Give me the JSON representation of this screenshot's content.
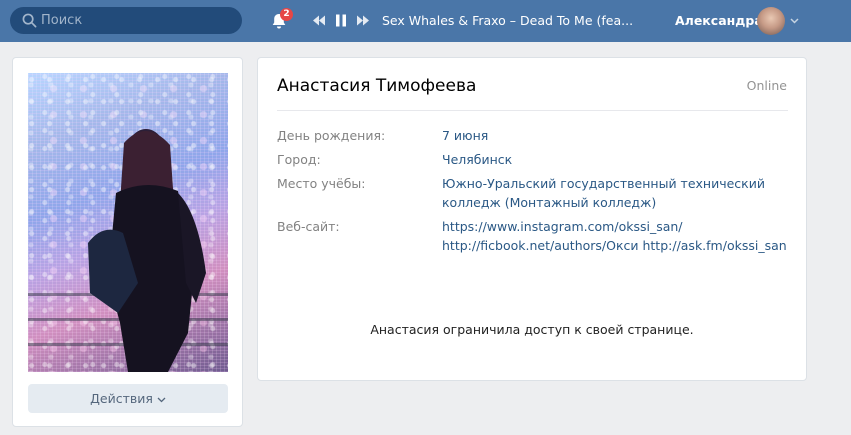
{
  "header": {
    "search_placeholder": "Поиск",
    "notifications_count": "2",
    "player_track": "Sex Whales & Fraxo – Dead To Me (fea...",
    "user_name": "Александра"
  },
  "profile_photo": {
    "action_label": "Действия"
  },
  "profile": {
    "name": "Анастасия Тимофеева",
    "status": "Online",
    "fields": [
      {
        "label": "День рождения:",
        "value": "7 июня"
      },
      {
        "label": "Город:",
        "value": "Челябинск"
      },
      {
        "label": "Место учёбы:",
        "value_line1": "Южно-Уральский государственный технический",
        "value_line2": "колледж (Монтажный колледж)"
      },
      {
        "label": "Веб-сайт:",
        "value_line1": "https://www.instagram.com/okssi_san/",
        "value_line2": "http://ficbook.net/authors/Окси http://ask.fm/okssi_san"
      }
    ],
    "restricted_notice": "Анастасия ограничила доступ к своей странице."
  },
  "colors": {
    "header_bg": "#4a76a8",
    "page_bg": "#edeef0",
    "link": "#2a5885",
    "badge": "#e64646"
  }
}
